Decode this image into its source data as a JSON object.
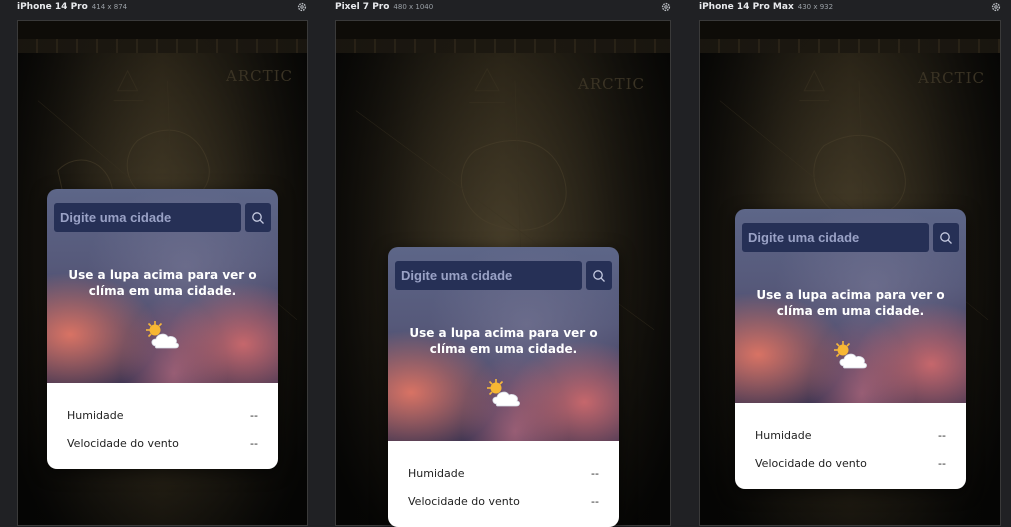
{
  "devices": [
    {
      "name": "iPhone 14 Pro",
      "dims": "414 x 874"
    },
    {
      "name": "Pixel 7 Pro",
      "dims": "480 x 1040"
    },
    {
      "name": "iPhone 14 Pro Max",
      "dims": "430 x 932"
    }
  ],
  "icons": {
    "settings": "gear-icon",
    "search": "search-icon",
    "weather": "partly-cloudy-icon"
  },
  "map": {
    "label": "ARCTIC"
  },
  "app": {
    "search_placeholder": "Digite uma cidade",
    "message": "Use a lupa acima para ver o clíma em uma cidade.",
    "humidity_label": "Humidade",
    "humidity_value": "--",
    "wind_label": "Velocidade do vento",
    "wind_value": "--"
  },
  "colors": {
    "input_bg": "#263056",
    "card_bottom": "#ffffff",
    "page_bg": "#202124"
  }
}
